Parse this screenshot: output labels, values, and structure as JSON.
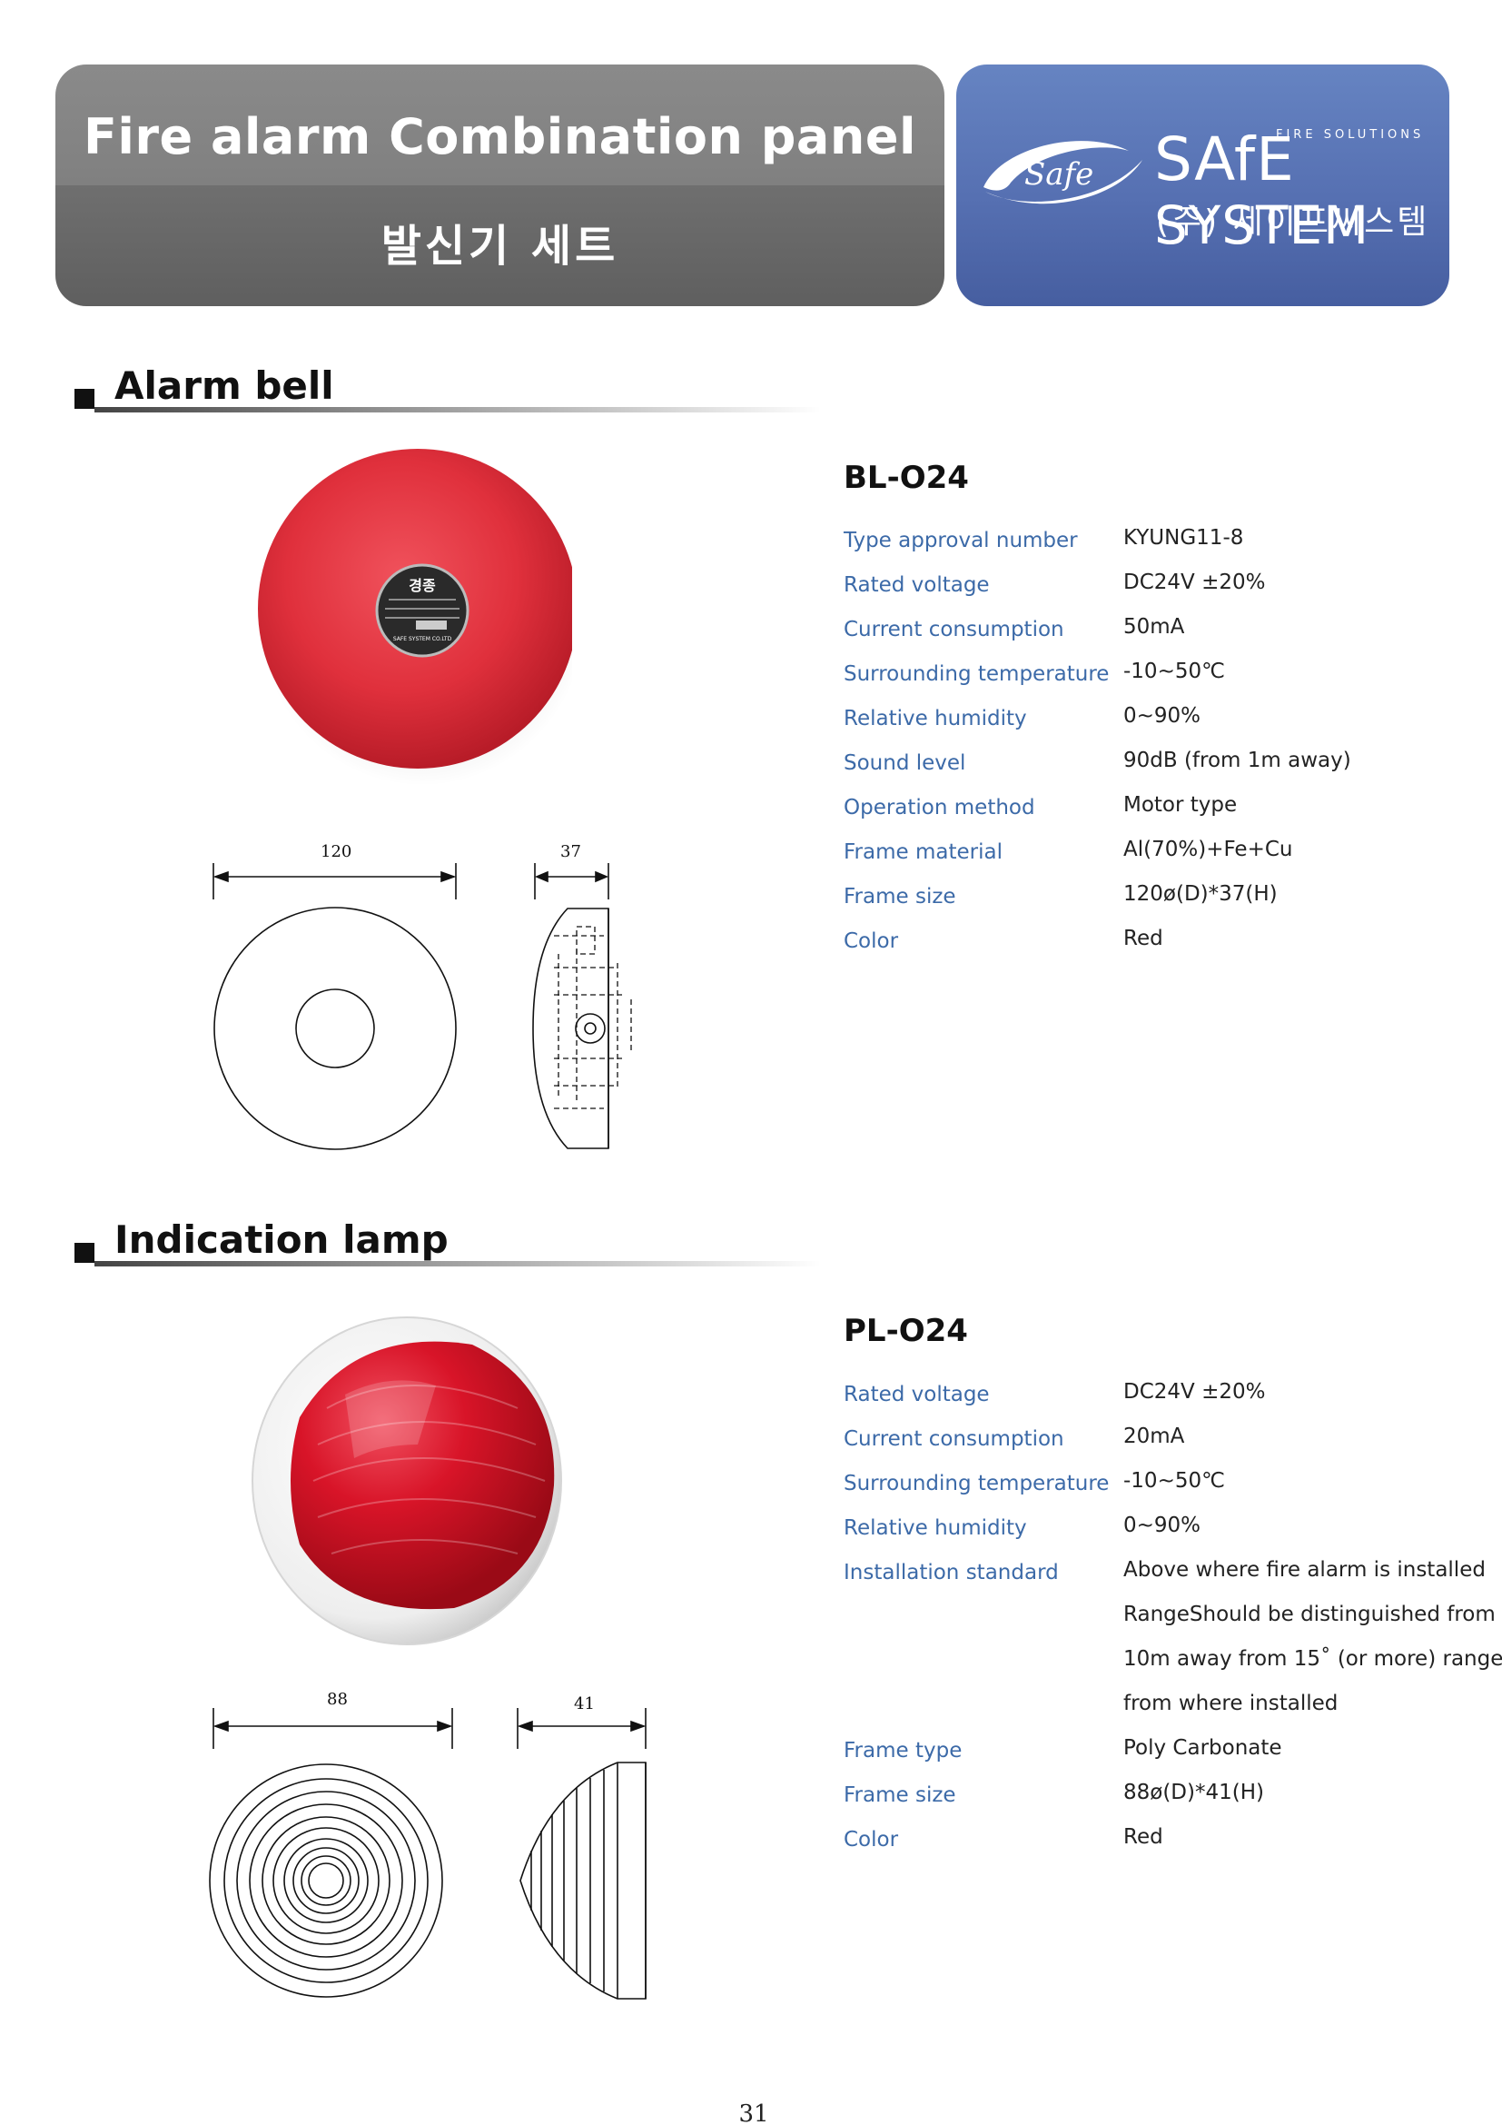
{
  "header": {
    "title": "Fire alarm Combination panel",
    "subtitle": "발신기 세트"
  },
  "logo": {
    "badge": "Safe",
    "tagline": "FIRE SOLUTIONS",
    "brand_safe": "SAfE",
    "brand_system": "SYSTEM",
    "korean": "(주) 세이프씨스템"
  },
  "colors": {
    "banner_left": "#808080",
    "banner_right": "#5670b2",
    "spec_label": "#3c6aa8",
    "bell_red": "#e2323c"
  },
  "sections": [
    {
      "heading": "Alarm bell",
      "model": "BL-O24",
      "dims": {
        "width": "120",
        "depth": "37"
      },
      "specs": [
        {
          "label": "Type approval number",
          "value": "KYUNG11-8"
        },
        {
          "label": "Rated voltage",
          "value": "DC24V ±20%"
        },
        {
          "label": "Current consumption",
          "value": "50mA"
        },
        {
          "label": "Surrounding temperature",
          "value": "-10~50℃"
        },
        {
          "label": "Relative humidity",
          "value": "0~90%"
        },
        {
          "label": "Sound level",
          "value": "90dB (from 1m away)"
        },
        {
          "label": "Operation method",
          "value": "Motor type"
        },
        {
          "label": "Frame material",
          "value": "Al(70%)+Fe+Cu"
        },
        {
          "label": "Frame size",
          "value": "120ø(D)*37(H)"
        },
        {
          "label": "Color",
          "value": "Red"
        }
      ],
      "nameplate": {
        "title": "경종",
        "company": "SAFE SYSTEM CO.LTD"
      }
    },
    {
      "heading": "Indication lamp",
      "model": "PL-O24",
      "dims": {
        "width": "88",
        "depth": "41"
      },
      "specs": [
        {
          "label": "Rated voltage",
          "value": "DC24V ±20%"
        },
        {
          "label": "Current consumption",
          "value": "20mA"
        },
        {
          "label": "Surrounding temperature",
          "value": "-10~50℃"
        },
        {
          "label": "Relative humidity",
          "value": "0~90%"
        },
        {
          "label": "Installation standard",
          "value": "Above where fire alarm is installed"
        },
        {
          "label": "",
          "value": "RangeShould be distinguished from"
        },
        {
          "label": "",
          "value": "10m away from 15˚ (or more) range"
        },
        {
          "label": "",
          "value": "from where installed"
        },
        {
          "label": "Frame type",
          "value": "Poly Carbonate"
        },
        {
          "label": "Frame size",
          "value": "88ø(D)*41(H)"
        },
        {
          "label": "Color",
          "value": "Red"
        }
      ]
    }
  ],
  "page_number": "31"
}
